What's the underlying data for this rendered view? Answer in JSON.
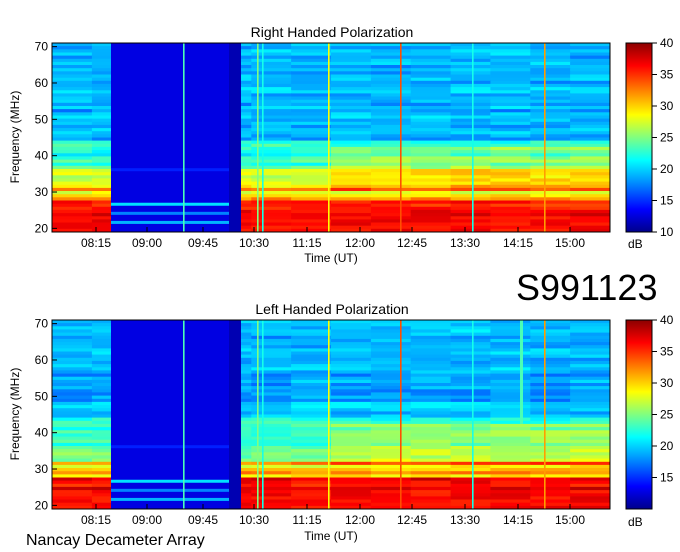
{
  "id_label": "S991123",
  "footer": "Nancay Decameter Array",
  "colorbar_unit": "dB",
  "chart_data": [
    {
      "type": "heatmap",
      "title": "Right Handed Polarization",
      "xlabel": "Time (UT)",
      "ylabel": "Frequency (MHz)",
      "x_ticks": [
        "08:15",
        "09:00",
        "09:45",
        "10:30",
        "11:15",
        "12:00",
        "12:45",
        "13:30",
        "14:15",
        "15:00"
      ],
      "y_ticks": [
        20,
        30,
        40,
        50,
        60,
        70
      ],
      "ylim": [
        19,
        71
      ],
      "color_ticks": [
        10,
        15,
        20,
        25,
        30,
        35,
        40
      ],
      "color_range": [
        10,
        40
      ],
      "colorscale": [
        "#00008b",
        "#0000ff",
        "#00a0ff",
        "#00ffff",
        "#80ff80",
        "#ffff00",
        "#ff8000",
        "#ff0000",
        "#8b0000"
      ]
    },
    {
      "type": "heatmap",
      "title": "Left Handed Polarization",
      "xlabel": "Time (UT)",
      "ylabel": "Frequency (MHz)",
      "x_ticks": [
        "08:15",
        "09:00",
        "09:45",
        "10:30",
        "11:15",
        "12:00",
        "12:45",
        "13:30",
        "14:15",
        "15:00"
      ],
      "y_ticks": [
        20,
        30,
        40,
        50,
        60,
        70
      ],
      "ylim": [
        19,
        71
      ],
      "color_ticks": [
        15,
        20,
        25,
        30,
        35,
        40
      ],
      "color_range": [
        10,
        40
      ],
      "colorscale": [
        "#00008b",
        "#0000ff",
        "#00a0ff",
        "#00ffff",
        "#80ff80",
        "#ffff00",
        "#ff8000",
        "#ff0000",
        "#8b0000"
      ]
    }
  ]
}
